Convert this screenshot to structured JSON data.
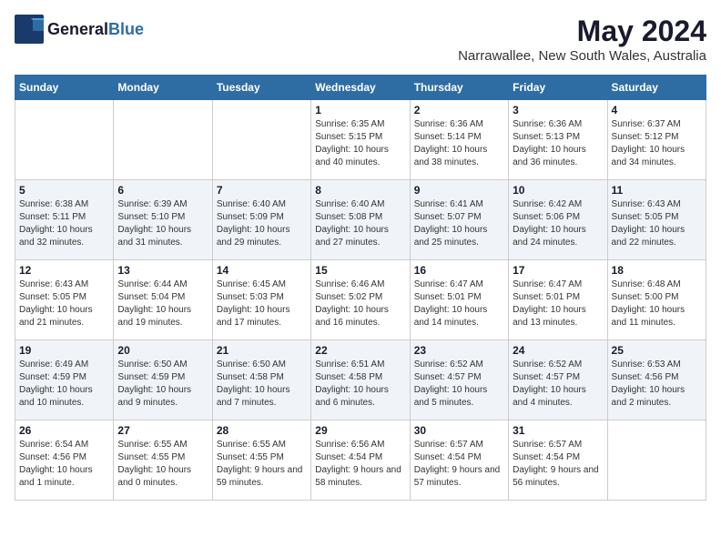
{
  "header": {
    "logo_general": "General",
    "logo_blue": "Blue",
    "month": "May 2024",
    "location": "Narrawallee, New South Wales, Australia"
  },
  "weekdays": [
    "Sunday",
    "Monday",
    "Tuesday",
    "Wednesday",
    "Thursday",
    "Friday",
    "Saturday"
  ],
  "weeks": [
    [
      {
        "day": "",
        "sunrise": "",
        "sunset": "",
        "daylight": ""
      },
      {
        "day": "",
        "sunrise": "",
        "sunset": "",
        "daylight": ""
      },
      {
        "day": "",
        "sunrise": "",
        "sunset": "",
        "daylight": ""
      },
      {
        "day": "1",
        "sunrise": "Sunrise: 6:35 AM",
        "sunset": "Sunset: 5:15 PM",
        "daylight": "Daylight: 10 hours and 40 minutes."
      },
      {
        "day": "2",
        "sunrise": "Sunrise: 6:36 AM",
        "sunset": "Sunset: 5:14 PM",
        "daylight": "Daylight: 10 hours and 38 minutes."
      },
      {
        "day": "3",
        "sunrise": "Sunrise: 6:36 AM",
        "sunset": "Sunset: 5:13 PM",
        "daylight": "Daylight: 10 hours and 36 minutes."
      },
      {
        "day": "4",
        "sunrise": "Sunrise: 6:37 AM",
        "sunset": "Sunset: 5:12 PM",
        "daylight": "Daylight: 10 hours and 34 minutes."
      }
    ],
    [
      {
        "day": "5",
        "sunrise": "Sunrise: 6:38 AM",
        "sunset": "Sunset: 5:11 PM",
        "daylight": "Daylight: 10 hours and 32 minutes."
      },
      {
        "day": "6",
        "sunrise": "Sunrise: 6:39 AM",
        "sunset": "Sunset: 5:10 PM",
        "daylight": "Daylight: 10 hours and 31 minutes."
      },
      {
        "day": "7",
        "sunrise": "Sunrise: 6:40 AM",
        "sunset": "Sunset: 5:09 PM",
        "daylight": "Daylight: 10 hours and 29 minutes."
      },
      {
        "day": "8",
        "sunrise": "Sunrise: 6:40 AM",
        "sunset": "Sunset: 5:08 PM",
        "daylight": "Daylight: 10 hours and 27 minutes."
      },
      {
        "day": "9",
        "sunrise": "Sunrise: 6:41 AM",
        "sunset": "Sunset: 5:07 PM",
        "daylight": "Daylight: 10 hours and 25 minutes."
      },
      {
        "day": "10",
        "sunrise": "Sunrise: 6:42 AM",
        "sunset": "Sunset: 5:06 PM",
        "daylight": "Daylight: 10 hours and 24 minutes."
      },
      {
        "day": "11",
        "sunrise": "Sunrise: 6:43 AM",
        "sunset": "Sunset: 5:05 PM",
        "daylight": "Daylight: 10 hours and 22 minutes."
      }
    ],
    [
      {
        "day": "12",
        "sunrise": "Sunrise: 6:43 AM",
        "sunset": "Sunset: 5:05 PM",
        "daylight": "Daylight: 10 hours and 21 minutes."
      },
      {
        "day": "13",
        "sunrise": "Sunrise: 6:44 AM",
        "sunset": "Sunset: 5:04 PM",
        "daylight": "Daylight: 10 hours and 19 minutes."
      },
      {
        "day": "14",
        "sunrise": "Sunrise: 6:45 AM",
        "sunset": "Sunset: 5:03 PM",
        "daylight": "Daylight: 10 hours and 17 minutes."
      },
      {
        "day": "15",
        "sunrise": "Sunrise: 6:46 AM",
        "sunset": "Sunset: 5:02 PM",
        "daylight": "Daylight: 10 hours and 16 minutes."
      },
      {
        "day": "16",
        "sunrise": "Sunrise: 6:47 AM",
        "sunset": "Sunset: 5:01 PM",
        "daylight": "Daylight: 10 hours and 14 minutes."
      },
      {
        "day": "17",
        "sunrise": "Sunrise: 6:47 AM",
        "sunset": "Sunset: 5:01 PM",
        "daylight": "Daylight: 10 hours and 13 minutes."
      },
      {
        "day": "18",
        "sunrise": "Sunrise: 6:48 AM",
        "sunset": "Sunset: 5:00 PM",
        "daylight": "Daylight: 10 hours and 11 minutes."
      }
    ],
    [
      {
        "day": "19",
        "sunrise": "Sunrise: 6:49 AM",
        "sunset": "Sunset: 4:59 PM",
        "daylight": "Daylight: 10 hours and 10 minutes."
      },
      {
        "day": "20",
        "sunrise": "Sunrise: 6:50 AM",
        "sunset": "Sunset: 4:59 PM",
        "daylight": "Daylight: 10 hours and 9 minutes."
      },
      {
        "day": "21",
        "sunrise": "Sunrise: 6:50 AM",
        "sunset": "Sunset: 4:58 PM",
        "daylight": "Daylight: 10 hours and 7 minutes."
      },
      {
        "day": "22",
        "sunrise": "Sunrise: 6:51 AM",
        "sunset": "Sunset: 4:58 PM",
        "daylight": "Daylight: 10 hours and 6 minutes."
      },
      {
        "day": "23",
        "sunrise": "Sunrise: 6:52 AM",
        "sunset": "Sunset: 4:57 PM",
        "daylight": "Daylight: 10 hours and 5 minutes."
      },
      {
        "day": "24",
        "sunrise": "Sunrise: 6:52 AM",
        "sunset": "Sunset: 4:57 PM",
        "daylight": "Daylight: 10 hours and 4 minutes."
      },
      {
        "day": "25",
        "sunrise": "Sunrise: 6:53 AM",
        "sunset": "Sunset: 4:56 PM",
        "daylight": "Daylight: 10 hours and 2 minutes."
      }
    ],
    [
      {
        "day": "26",
        "sunrise": "Sunrise: 6:54 AM",
        "sunset": "Sunset: 4:56 PM",
        "daylight": "Daylight: 10 hours and 1 minute."
      },
      {
        "day": "27",
        "sunrise": "Sunrise: 6:55 AM",
        "sunset": "Sunset: 4:55 PM",
        "daylight": "Daylight: 10 hours and 0 minutes."
      },
      {
        "day": "28",
        "sunrise": "Sunrise: 6:55 AM",
        "sunset": "Sunset: 4:55 PM",
        "daylight": "Daylight: 9 hours and 59 minutes."
      },
      {
        "day": "29",
        "sunrise": "Sunrise: 6:56 AM",
        "sunset": "Sunset: 4:54 PM",
        "daylight": "Daylight: 9 hours and 58 minutes."
      },
      {
        "day": "30",
        "sunrise": "Sunrise: 6:57 AM",
        "sunset": "Sunset: 4:54 PM",
        "daylight": "Daylight: 9 hours and 57 minutes."
      },
      {
        "day": "31",
        "sunrise": "Sunrise: 6:57 AM",
        "sunset": "Sunset: 4:54 PM",
        "daylight": "Daylight: 9 hours and 56 minutes."
      },
      {
        "day": "",
        "sunrise": "",
        "sunset": "",
        "daylight": ""
      }
    ]
  ]
}
